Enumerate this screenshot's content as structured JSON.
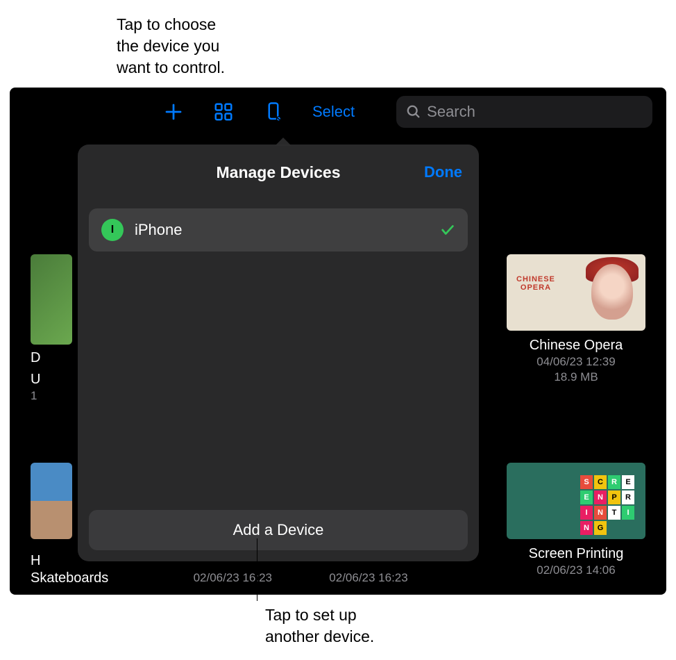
{
  "callouts": {
    "top": "Tap to choose\nthe device you\nwant to control.",
    "bottom": "Tap to set up\nanother device."
  },
  "toolbar": {
    "select_label": "Select",
    "search_placeholder": "Search"
  },
  "popover": {
    "title": "Manage Devices",
    "done_label": "Done",
    "devices": [
      {
        "badge": "I",
        "name": "iPhone",
        "checked": true
      }
    ],
    "add_label": "Add a Device"
  },
  "items": {
    "left_partial_1": {
      "title_lines": [
        "D",
        "U"
      ],
      "meta": "1"
    },
    "right_1": {
      "title": "Chinese Opera",
      "date": "04/06/23 12:39",
      "size": "18.9 MB",
      "thumb_text": "CHINESE\nOPERA"
    },
    "left_partial_2": {
      "title_lines": [
        "H"
      ]
    },
    "right_2": {
      "title": "Screen Printing",
      "date": "02/06/23 14:06"
    },
    "bottom_row": {
      "col1_title": "Skateboards",
      "col2_date": "02/06/23 16:23",
      "col3_date": "02/06/23 16:23"
    }
  }
}
